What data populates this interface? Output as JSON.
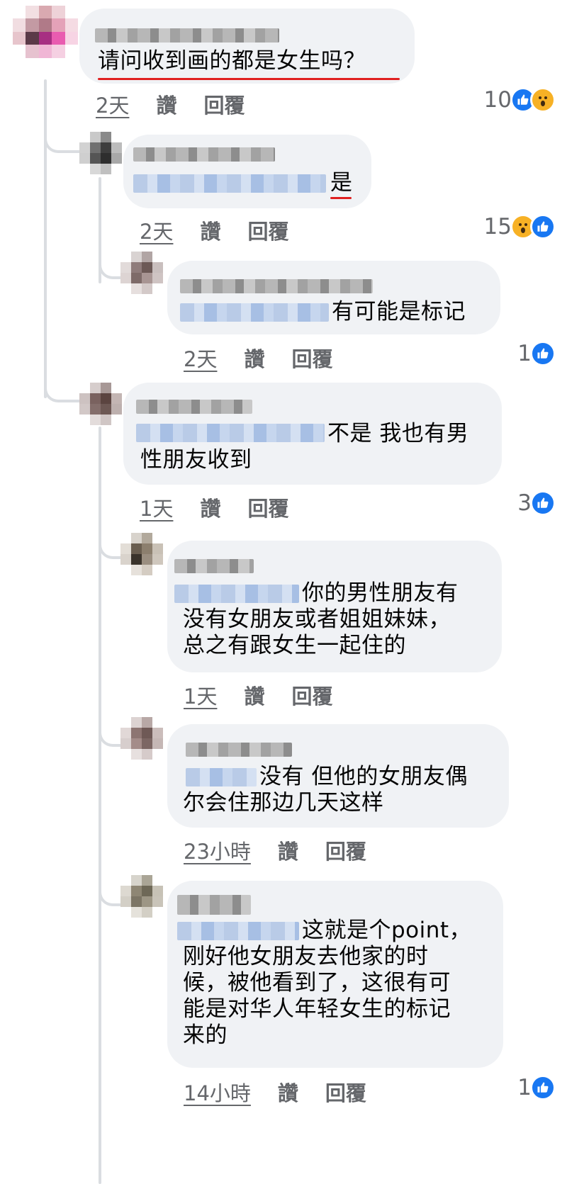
{
  "comments": [
    {
      "text": "请问收到画的都是女生吗？",
      "time": "2天",
      "like": "讚",
      "reply": "回覆",
      "reaction_count": "10",
      "reactions": [
        "like-icon",
        "wow-icon"
      ]
    },
    {
      "text": "是",
      "time": "2天",
      "like": "讚",
      "reply": "回覆",
      "reaction_count": "15",
      "reactions": [
        "wow-icon",
        "like-icon"
      ]
    },
    {
      "text": "有可能是标记",
      "time": "2天",
      "like": "讚",
      "reply": "回覆",
      "reaction_count": "1",
      "reactions": [
        "like-icon"
      ]
    },
    {
      "text": "不是 我也有男\n性朋友收到",
      "time": "1天",
      "like": "讚",
      "reply": "回覆",
      "reaction_count": "3",
      "reactions": [
        "like-icon"
      ]
    },
    {
      "text": "你的男性朋友有\n没有女朋友或者姐姐妹妹，\n总之有跟女生一起住的",
      "time": "1天",
      "like": "讚",
      "reply": "回覆"
    },
    {
      "text": "没有 但他的女朋友偶\n尔会住那边几天这样",
      "time": "23小時",
      "like": "讚",
      "reply": "回覆"
    },
    {
      "text": "这就是个point，\n刚好他女朋友去他家的时\n候，被他看到了，这很有可\n能是对华人年轻女生的标记\n来的",
      "time": "14小時",
      "like": "讚",
      "reply": "回覆",
      "reaction_count": "1",
      "reactions": [
        "like-icon"
      ]
    }
  ],
  "colors": {
    "like": "#1877f2",
    "wow": "#f7b125",
    "bubble": "#f0f2f5",
    "meta": "#65676b",
    "underline": "#e02020"
  }
}
